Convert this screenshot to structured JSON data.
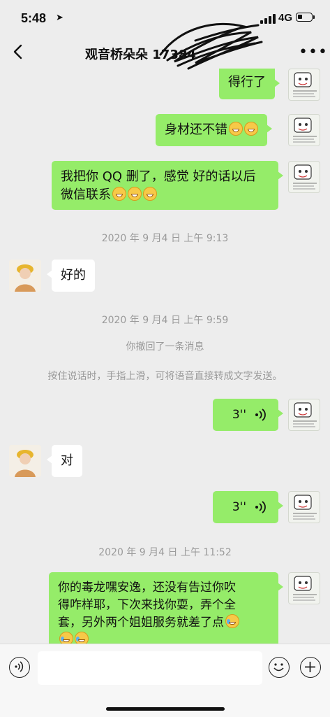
{
  "status_bar": {
    "time": "5:48",
    "network": "4G"
  },
  "nav": {
    "title": "观音桥朵朵 17384"
  },
  "avatars": {
    "self_caption_lines": [
      "这个是一张可爱",
      "小表情，快来使用它吧",
      "我的表情包说不好~"
    ]
  },
  "messages": {
    "m1": "得行了",
    "m2": "身材还不错",
    "m3_line1": "我把你 QQ 删了，感觉 好的话以后",
    "m3_line2": "微信联系",
    "ts1": "2020 年 9 月4 日 上午 9:13",
    "m4": "好的",
    "ts2": "2020 年 9 月4 日 上午 9:59",
    "recall": "你撤回了一条消息",
    "hint": "按住说话时，手指上滑，可将语音直接转成文字发送。",
    "voice1": "3''",
    "m5": "对",
    "voice2": "3''",
    "ts3": "2020 年 9 月4 日 上午 11:52",
    "m6_line1": "你的毒龙嘿安逸，还没有告过你吹",
    "m6_line2": "得咋样耶，下次来找你耍，弄个全",
    "m6_line3": "套，另外两个姐姐服务就差了点"
  },
  "input": {
    "placeholder": ""
  },
  "colors": {
    "bubble_self": "#95ec69",
    "bubble_other": "#ffffff",
    "background": "#ededed"
  },
  "icons": [
    "back-chevron-icon",
    "more-icon",
    "voice-icon",
    "emoji-icon",
    "plus-icon"
  ]
}
